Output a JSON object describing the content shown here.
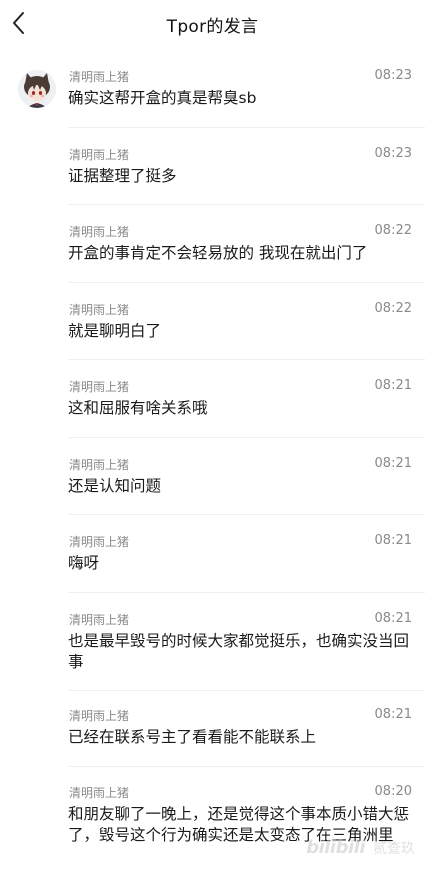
{
  "header": {
    "title": "Tpor的发言"
  },
  "messages": [
    {
      "name": "清明雨上猪",
      "time": "08:23",
      "text": "确实这帮开盒的真是帮臭sb"
    },
    {
      "name": "清明雨上猪",
      "time": "08:23",
      "text": "证据整理了挺多"
    },
    {
      "name": "清明雨上猪",
      "time": "08:22",
      "text": "开盒的事肯定不会轻易放的 我现在就出门了"
    },
    {
      "name": "清明雨上猪",
      "time": "08:22",
      "text": "就是聊明白了"
    },
    {
      "name": "清明雨上猪",
      "time": "08:21",
      "text": "这和屈服有啥关系哦"
    },
    {
      "name": "清明雨上猪",
      "time": "08:21",
      "text": "还是认知问题"
    },
    {
      "name": "清明雨上猪",
      "time": "08:21",
      "text": "嗨呀"
    },
    {
      "name": "清明雨上猪",
      "time": "08:21",
      "text": "也是最早毁号的时候大家都觉挺乐，也确实没当回事"
    },
    {
      "name": "清明雨上猪",
      "time": "08:21",
      "text": "已经在联系号主了看看能不能联系上"
    },
    {
      "name": "清明雨上猪",
      "time": "08:20",
      "text": "和朋友聊了一晚上，还是觉得这个事本质小错大惩了，毁号这个行为确实还是太变态了在三角洲里"
    }
  ],
  "watermark": {
    "logo": "bilibili",
    "text": "贰查玖"
  },
  "colors": {
    "name": "#8a8a8a",
    "time": "#8a8a8a",
    "text": "#1a1a1a",
    "divider": "#eeeeee"
  }
}
